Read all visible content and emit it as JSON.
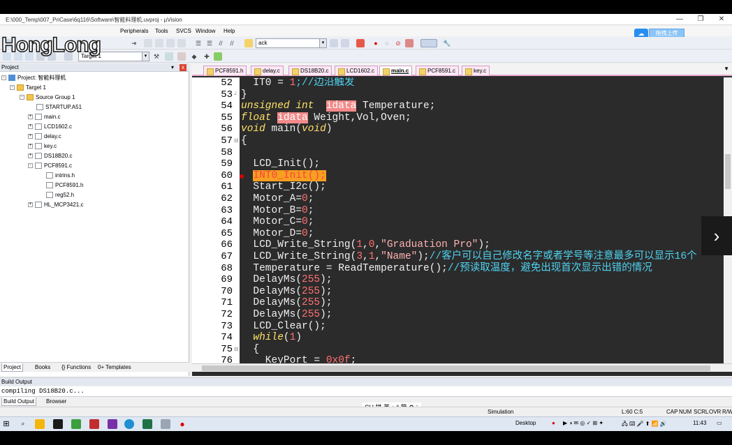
{
  "window": {
    "title": "E:\\000_Temp\\007_PriCase\\6q116\\Software\\智能料理机.uvproj - µVision",
    "min": "—",
    "max": "❐",
    "close": "✕"
  },
  "watermark": "HongLong",
  "menu": [
    "Peripherals",
    "Tools",
    "SVCS",
    "Window",
    "Help"
  ],
  "cloud": {
    "icon": "☁",
    "label": "拖拽上传"
  },
  "toolbar": {
    "find_text": "ack",
    "target": "Target 1"
  },
  "project": {
    "header": "Project",
    "pin": "▾",
    "close": "x",
    "root": "Project: 智能料理机",
    "target": "Target 1",
    "group": "Source Group 1",
    "files": [
      "STARTUP.A51",
      "main.c",
      "LCD1602.c",
      "delay.c",
      "key.c",
      "DS18B20.c",
      "PCF8591.c"
    ],
    "sub_files": [
      "intrins.h",
      "PCF8591.h",
      "reg52.h"
    ],
    "last_file": "HL_MCP3421.c"
  },
  "panel_tabs": [
    "Project",
    "Books",
    "{} Functions",
    "0+ Templates"
  ],
  "editor_tabs": [
    "PCF8591.h",
    "delay.c",
    "DS18B20.c",
    "LCD1602.c",
    "main.c",
    "PCF8591.c",
    "key.c"
  ],
  "active_tab": "main.c",
  "line_numbers": [
    "52",
    "53",
    "54",
    "55",
    "56",
    "57",
    "58",
    "59",
    "60",
    "61",
    "62",
    "63",
    "64",
    "65",
    "66",
    "67",
    "68",
    "69",
    "70",
    "71",
    "72",
    "73",
    "74",
    "75",
    "76"
  ],
  "code": {
    "l52a": "  IT0 = ",
    "l52n": "1",
    "l52c": ";//边沿触发",
    "l53": "}",
    "l54k": "unsigned int",
    "l54s": "  ",
    "l54h": "idata",
    "l54t": " Temperature;",
    "l55k": "float",
    "l55s": " ",
    "l55h": "idata",
    "l55t": " Weight,Vol,Oven;",
    "l56k": "void",
    "l56t": " main(",
    "l56k2": "void",
    "l56e": ")",
    "l57": "{",
    "l59": "  LCD_Init();",
    "l60": "INT0_Init();",
    "l61": "  Start_I2c();",
    "l62a": "  Motor_A=",
    "l62n": "0",
    "l62e": ";",
    "l63a": "  Motor_B=",
    "l63n": "0",
    "l63e": ";",
    "l64a": "  Motor_C=",
    "l64n": "0",
    "l64e": ";",
    "l65a": "  Motor_D=",
    "l65n": "0",
    "l65e": ";",
    "l66a": "  LCD_Write_String(",
    "l66n1": "1",
    "l66b": ",",
    "l66n2": "0",
    "l66c": ",",
    "l66s": "\"Graduation Pro\"",
    "l66e": ");",
    "l67a": "  LCD_Write_String(",
    "l67n1": "3",
    "l67b": ",",
    "l67n2": "1",
    "l67c": ",",
    "l67s": "\"Name\"",
    "l67e": ");",
    "l67m": "//客户可以自己修改名字或者学号等注意最多可以显示16个",
    "l68a": "  Temperature = ReadTemperature();",
    "l68m": "//预读取温度，避免出现首次显示出错的情况",
    "l69a": "  DelayMs(",
    "l69n": "255",
    "l69e": ");",
    "l70a": "  DelayMs(",
    "l70n": "255",
    "l70e": ");",
    "l71a": "  DelayMs(",
    "l71n": "255",
    "l71e": ");",
    "l72a": "  DelayMs(",
    "l72n": "255",
    "l72e": ");",
    "l73": "  LCD_Clear();",
    "l74s": "  ",
    "l74k": "while",
    "l74t": "(",
    "l74n": "1",
    "l74e": ")",
    "l75": "  {",
    "l76a": "    KeyPort = ",
    "l76n": "0x0f",
    "l76e": ";"
  },
  "build": {
    "header": "Build Output",
    "text": "compiling DS18B20.c...",
    "tabs": [
      "Build Output",
      "Browser"
    ]
  },
  "ime": "CH 拼 英 ♪ ° 简 ⚙ ⁝",
  "status": {
    "mode": "Simulation",
    "pos": "L:60 C:5",
    "caps": "CAP",
    "num": "NUM",
    "scrl": "SCRL",
    "ovr": "OVR",
    "rw": "R/W"
  },
  "taskbar": {
    "desktop": "Desktop",
    "time": "11:43"
  },
  "colors": {
    "keyword": "#ffe066",
    "number": "#ff7070",
    "comment": "#4fd2f0",
    "editor_bg": "#2b2b2b"
  }
}
